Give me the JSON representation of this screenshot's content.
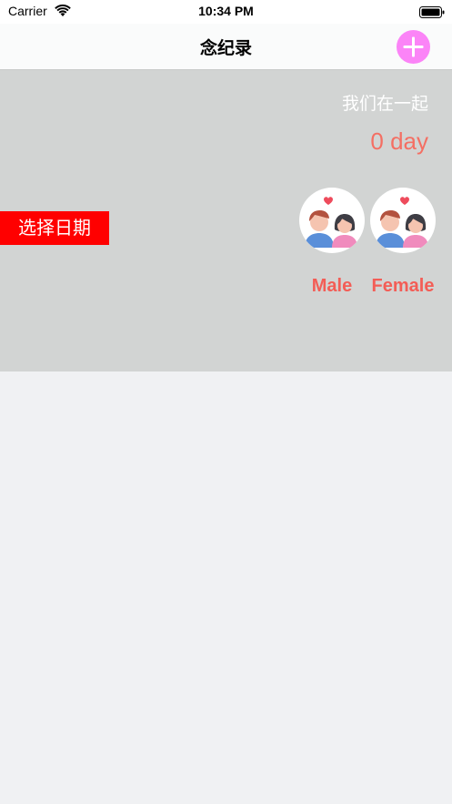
{
  "status_bar": {
    "carrier": "Carrier",
    "time": "10:34 PM",
    "icons": [
      "wifi-icon",
      "battery-icon"
    ]
  },
  "nav": {
    "title": "念纪录",
    "add_icon": "plus-icon"
  },
  "header": {
    "together_label": "我们在一起",
    "days_count": "0 day",
    "select_date_label": "选择日期",
    "male_label": "Male",
    "female_label": "Female",
    "avatar_icon": "couple-heart-icon"
  },
  "colors": {
    "header_bg": "#d2d4d3",
    "page_bg": "#f0f1f3",
    "add_button": "#fb84f7",
    "days_text": "#f46f63",
    "select_date_bg": "#ff0000",
    "gender_text": "#f35d56"
  }
}
